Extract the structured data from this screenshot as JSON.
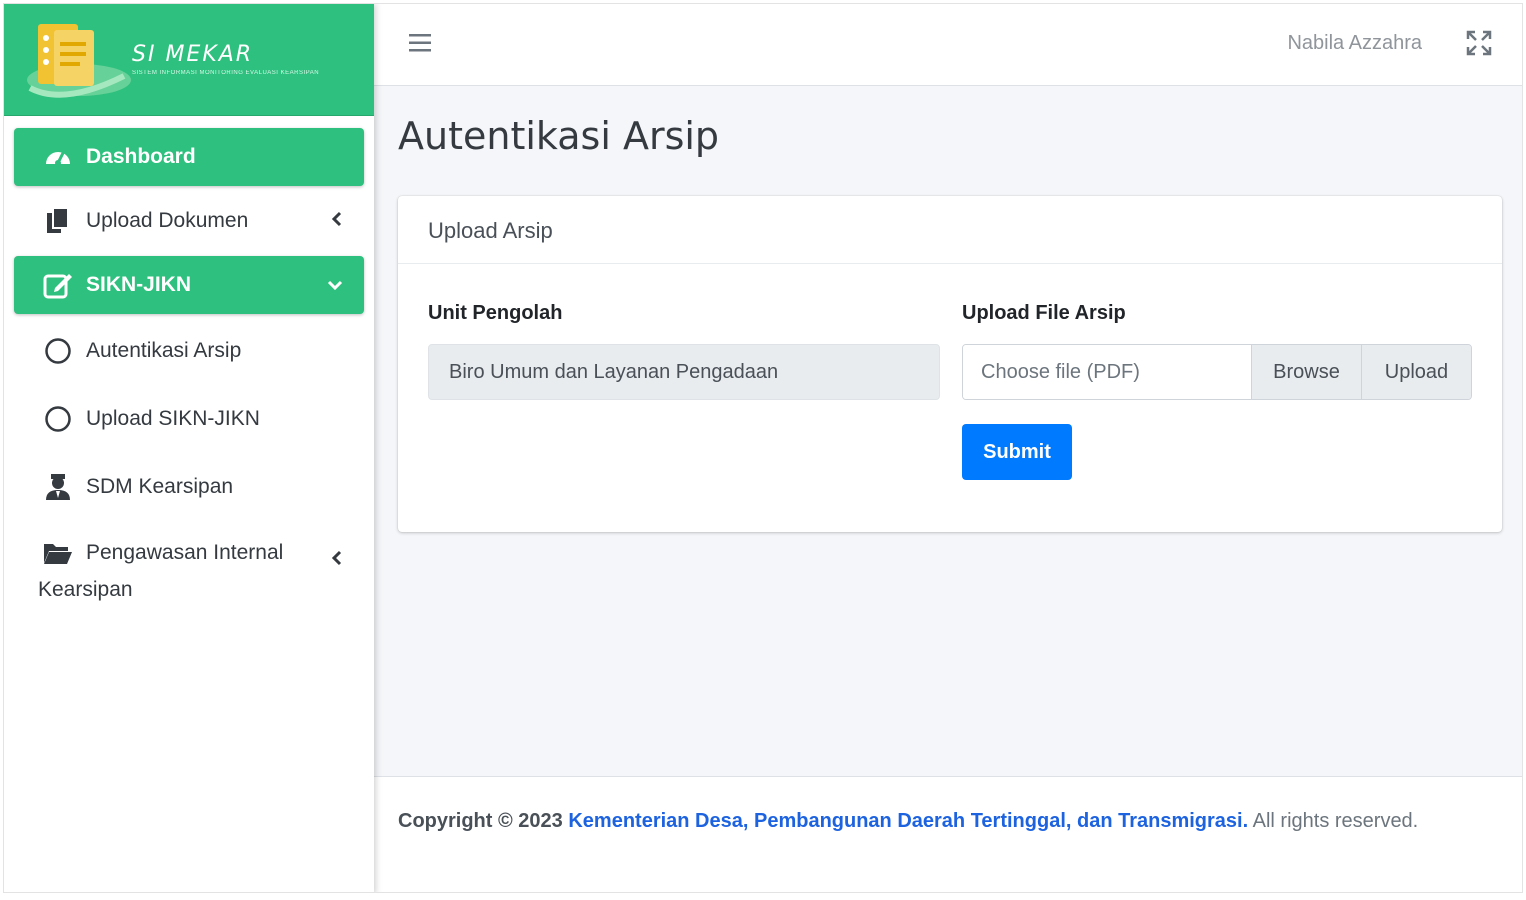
{
  "brand": {
    "name": "SI MEKAR",
    "tagline": "SISTEM INFORMASI MONITORING EVALUASI KEARSIPAN"
  },
  "sidebar": {
    "items": [
      {
        "label": "Dashboard",
        "icon": "dashboard-gauge-icon",
        "active": true
      },
      {
        "label": "Upload Dokumen",
        "icon": "copy-documents-icon",
        "chevron": "chevron-left-icon"
      },
      {
        "label": "SIKN-JIKN",
        "icon": "edit-square-icon",
        "active": true,
        "chevron": "chevron-down-icon"
      },
      {
        "label": "Autentikasi Arsip",
        "icon": "circle-outline-icon"
      },
      {
        "label": "Upload SIKN-JIKN",
        "icon": "circle-outline-icon"
      },
      {
        "label": "SDM Kearsipan",
        "icon": "user-tie-icon"
      },
      {
        "label_line1": "Pengawasan Internal",
        "label_line2": "Kearsipan",
        "icon": "folder-open-icon",
        "chevron": "chevron-left-icon"
      }
    ],
    "colors": {
      "accent": "#2ec07e"
    }
  },
  "topbar": {
    "menu_icon": "hamburger-menu-icon",
    "user_name": "Nabila Azzahra",
    "fullscreen_icon": "expand-arrows-icon"
  },
  "page": {
    "title": "Autentikasi Arsip"
  },
  "card": {
    "title": "Upload Arsip",
    "unit": {
      "label": "Unit Pengolah",
      "value": "Biro Umum dan Layanan Pengadaan"
    },
    "file": {
      "label": "Upload File Arsip",
      "placeholder": "Choose file (PDF)",
      "browse_label": "Browse",
      "upload_label": "Upload"
    },
    "submit_label": "Submit"
  },
  "footer": {
    "copyright": "Copyright © 2023",
    "org_link": "Kementerian Desa, Pembangunan Daerah Tertinggal, dan Transmigrasi.",
    "rights": "All rights reserved."
  },
  "colors": {
    "primary": "#007bff",
    "link": "#1d63e0",
    "background": "#f4f6f9"
  }
}
